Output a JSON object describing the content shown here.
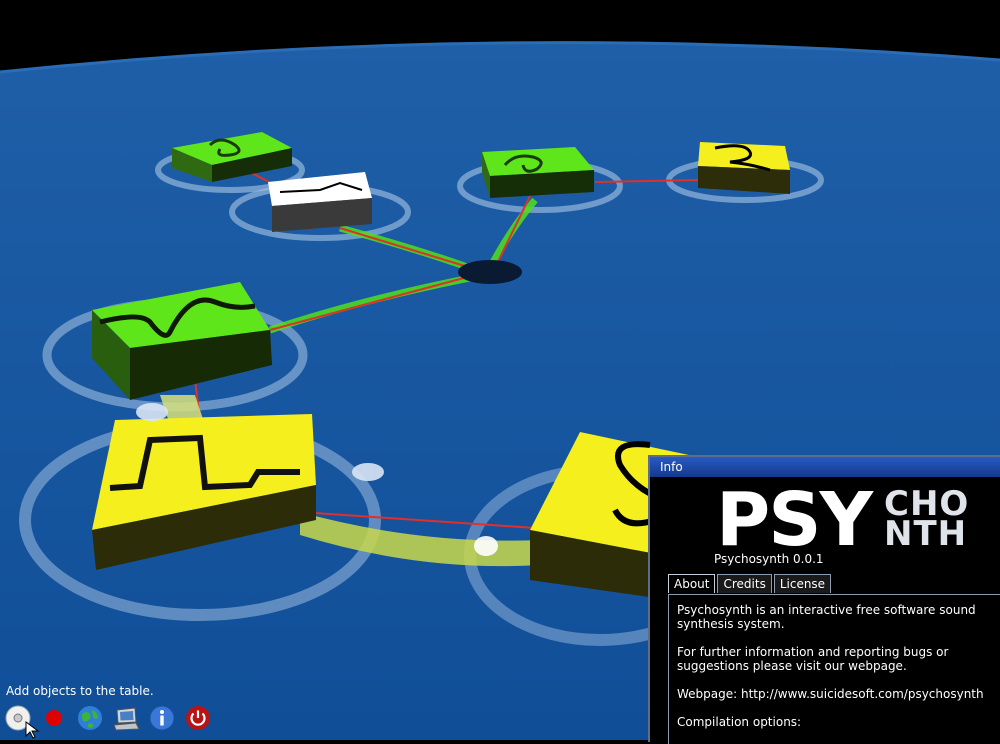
{
  "hint": "Add objects to the table.",
  "toolbar": {
    "buttons": [
      {
        "name": "add-object-button",
        "icon": "disc-icon"
      },
      {
        "name": "record-button",
        "icon": "record-icon"
      },
      {
        "name": "network-button",
        "icon": "globe-icon"
      },
      {
        "name": "settings-button",
        "icon": "computer-icon"
      },
      {
        "name": "info-button",
        "icon": "info-icon"
      },
      {
        "name": "quit-button",
        "icon": "power-icon"
      }
    ]
  },
  "info_window": {
    "title": "Info",
    "logo_big": "PSY",
    "logo_small_top": "CHO",
    "logo_small_bottom": "NTH",
    "version": "Psychosynth 0.0.1",
    "tabs": [
      {
        "label": "About"
      },
      {
        "label": "Credits"
      },
      {
        "label": "License"
      }
    ],
    "about": {
      "p1": "Psychosynth is an interactive free software sound\nsynthesis system.",
      "p2": "For further information and reporting bugs or\nsuggestions please visit our webpage.",
      "p3": "Webpage: http://www.suicidesoft.com/psychosynth",
      "p4": "Compilation options:"
    }
  },
  "colors": {
    "table_blue": "#1054a0",
    "module_green": "#5fe61a",
    "module_yellow": "#f5f01d",
    "link_red": "#e03a2e"
  }
}
